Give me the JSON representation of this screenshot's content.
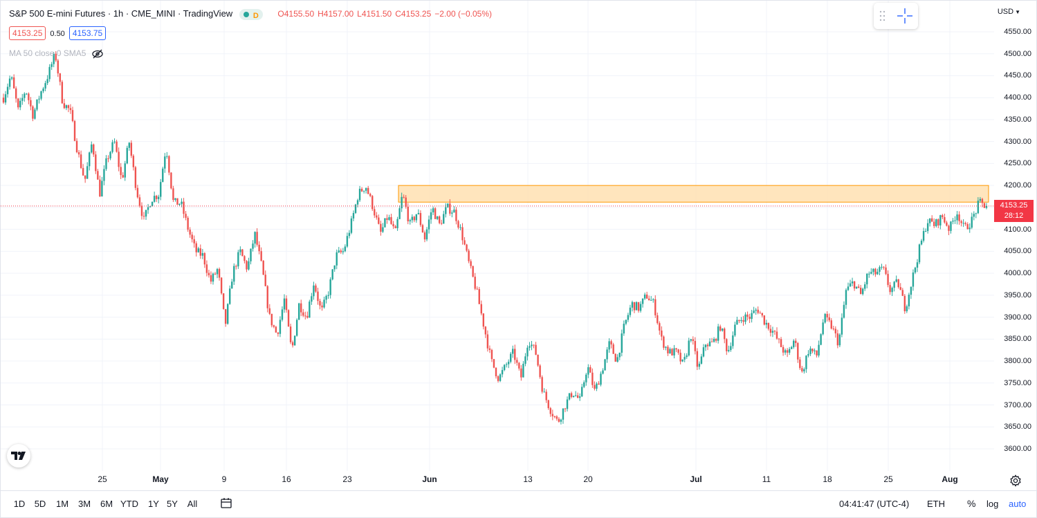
{
  "legend": {
    "title": "S&P 500 E-mini Futures · 1h · CME_MINI · TradingView",
    "interval_badge": "D",
    "open": "O4155.50",
    "high": "H4157.00",
    "low": "L4151.50",
    "close": "C4153.25",
    "change": "−2.00 (−0.05%)"
  },
  "quotes": {
    "bid": "4153.25",
    "spread": "0.50",
    "ask": "4153.75"
  },
  "indicator": {
    "label": "MA 50 close 0 SMA5"
  },
  "price_axis": {
    "currency": "USD",
    "ticks": [
      "4550.00",
      "4500.00",
      "4450.00",
      "4400.00",
      "4350.00",
      "4300.00",
      "4250.00",
      "4200.00",
      "4150.00",
      "4100.00",
      "4050.00",
      "4000.00",
      "3950.00",
      "3900.00",
      "3850.00",
      "3800.00",
      "3750.00",
      "3700.00",
      "3650.00",
      "3600.00"
    ],
    "current_price": "4153.25",
    "countdown": "28:12"
  },
  "time_axis": {
    "ticks": [
      {
        "label": "25",
        "bold": false
      },
      {
        "label": "May",
        "bold": true
      },
      {
        "label": "9",
        "bold": false
      },
      {
        "label": "16",
        "bold": false
      },
      {
        "label": "23",
        "bold": false
      },
      {
        "label": "Jun",
        "bold": true
      },
      {
        "label": "13",
        "bold": false
      },
      {
        "label": "20",
        "bold": false
      },
      {
        "label": "Jul",
        "bold": true
      },
      {
        "label": "11",
        "bold": false
      },
      {
        "label": "18",
        "bold": false
      },
      {
        "label": "25",
        "bold": false
      },
      {
        "label": "Aug",
        "bold": true
      }
    ]
  },
  "bottom_bar": {
    "ranges": [
      "1D",
      "5D",
      "1M",
      "3M",
      "6M",
      "YTD",
      "1Y",
      "5Y",
      "All"
    ],
    "time": "04:41:47 (UTC-4)",
    "session": "ETH",
    "percent": "%",
    "log": "log",
    "auto": "auto"
  },
  "zone": {
    "top": 4200,
    "bottom": 4162,
    "fill": "#ffe0b2",
    "stroke": "#ff9800"
  },
  "colors": {
    "up": "#26a69a",
    "down": "#ef5350",
    "accent": "#2962ff",
    "price_label": "#f23645"
  },
  "chart_data": {
    "type": "candlestick",
    "series": [
      {
        "name": "",
        "path": [
          4400,
          4450,
          4370,
          4420,
          4360,
          4410,
          4450,
          4500,
          4390,
          4370,
          4280,
          4210,
          4300,
          4180,
          4260,
          4300,
          4210,
          4300,
          4190,
          4120,
          4170,
          4180,
          4290,
          4160,
          4160,
          4100,
          4050,
          4040,
          3980,
          4010,
          3880,
          4000,
          4050,
          4010,
          4090,
          4010,
          3900,
          3860,
          3940,
          3820,
          3930,
          3900,
          3980,
          3910,
          3960,
          4040,
          4050,
          4110,
          4180,
          4200,
          4150,
          4090,
          4130,
          4090,
          4180,
          4110,
          4140,
          4080,
          4150,
          4110,
          4150,
          4140,
          4090,
          4020,
          3960,
          3880,
          3800,
          3760,
          3790,
          3820,
          3760,
          3850,
          3820,
          3730,
          3690,
          3660,
          3700,
          3730,
          3710,
          3790,
          3730,
          3780,
          3840,
          3800,
          3880,
          3930,
          3920,
          3950,
          3930,
          3850,
          3820,
          3820,
          3790,
          3860,
          3780,
          3840,
          3840,
          3880,
          3820,
          3880,
          3900,
          3900,
          3920,
          3890,
          3870,
          3840,
          3810,
          3850,
          3770,
          3830,
          3810,
          3900,
          3880,
          3840,
          3960,
          3980,
          3950,
          4000,
          4000,
          4010,
          3960,
          3980,
          3920,
          3990,
          4060,
          4120,
          4110,
          4130,
          4100,
          4140,
          4100,
          4120,
          4160,
          4153
        ],
        "low_min": 3640,
        "high_max": 4500
      }
    ],
    "ylim": [
      3585,
      4580
    ],
    "grid": true
  }
}
